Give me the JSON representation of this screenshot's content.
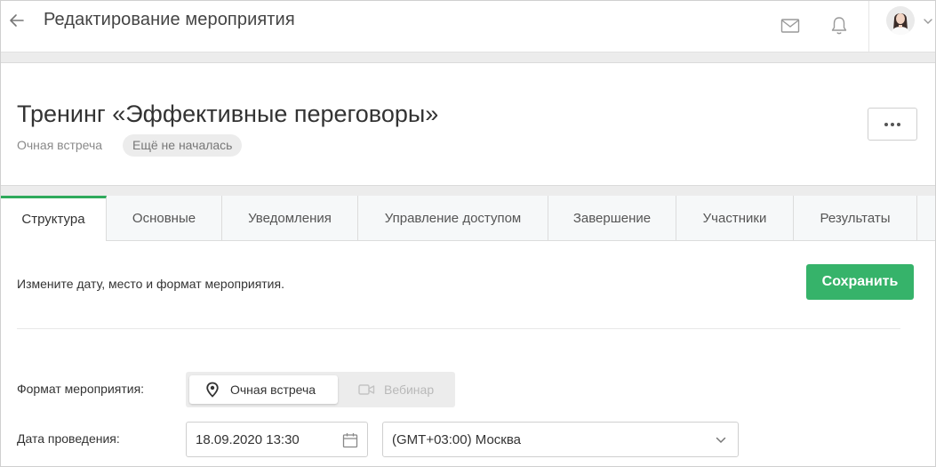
{
  "header": {
    "title": "Редактирование мероприятия",
    "icons": [
      "arrow-left-icon",
      "mail-icon",
      "bell-icon",
      "avatar",
      "chevron-down-icon"
    ]
  },
  "event": {
    "title": "Тренинг «Эффективные переговоры»",
    "type": "Очная встреча",
    "status": "Ещё не началась"
  },
  "tabs": [
    {
      "label": "Структура",
      "active": true
    },
    {
      "label": "Основные",
      "active": false
    },
    {
      "label": "Уведомления",
      "active": false
    },
    {
      "label": "Управление доступом",
      "active": false
    },
    {
      "label": "Завершение",
      "active": false
    },
    {
      "label": "Участники",
      "active": false
    },
    {
      "label": "Результаты",
      "active": false
    }
  ],
  "content": {
    "instruction": "Измените дату, место и формат мероприятия.",
    "save_label": "Сохранить",
    "format_label": "Формат мероприятия:",
    "format_options": [
      {
        "label": "Очная встреча",
        "icon": "map-pin-icon",
        "selected": true
      },
      {
        "label": "Вебинар",
        "icon": "video-camera-icon",
        "selected": false
      }
    ],
    "date_label": "Дата проведения:",
    "date_value": "18.09.2020 13:30",
    "timezone_value": "(GMT+03:00) Москва"
  },
  "colors": {
    "accent": "#36b36a",
    "tab_active_border": "#2faa5c"
  }
}
